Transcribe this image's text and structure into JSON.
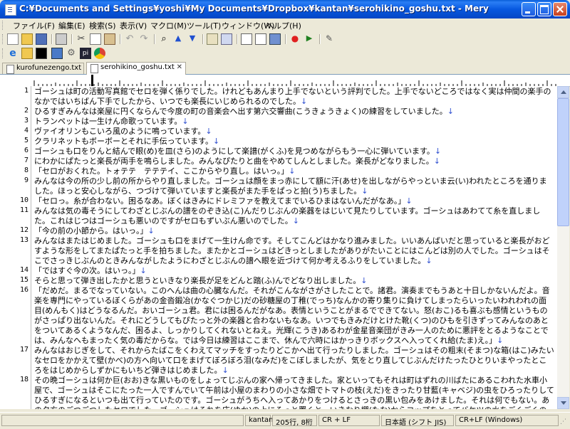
{
  "window": {
    "title": "C:¥Documents and Settings¥yoshi¥My Documents¥Dropbox¥kantan¥serohikino_goshu.txt - Mery"
  },
  "menu": [
    "ファイル(F)",
    "編集(E)",
    "検索(S)",
    "表示(V)",
    "マクロ(M)",
    "ツール(T)",
    "ウィンドウ(W)",
    "ヘルプ(H)"
  ],
  "toolbar": {
    "row1": [
      "new-file-icon",
      "open-file-icon",
      "save-icon",
      "print-icon",
      "cut-icon",
      "copy-icon",
      "paste-icon",
      "undo-icon",
      "redo-icon",
      "find-icon",
      "find-previous-icon",
      "find-next-icon",
      "replace-icon",
      "jump-icon",
      "word-wrap-icon",
      "window-icon",
      "split-icon",
      "record-macro-icon",
      "play-macro-icon",
      "tool-icon"
    ],
    "row2": [
      "ie-icon",
      "folder-icon",
      "command-prompt-icon",
      "notepad-icon",
      "settings-icon",
      "pdf-icon",
      "chrome-icon"
    ]
  },
  "tabs": [
    {
      "label": "kurofunezengo.txt",
      "active": false
    },
    {
      "label": "serohikino_goshu.txt",
      "active": true
    }
  ],
  "editor": {
    "lines": [
      {
        "num": "1",
        "text": "ゴーシュは町の活動写真館でセロを弾く係りでした。けれどもあんまり上手でないという評判でした。上手でないどころではなく実は仲間の楽手のなかではいちばん下手でしたから、いつでも楽長にいじめられるのでした。"
      },
      {
        "num": "2",
        "text": "ひるすぎみんなは楽屋に円くならんで今度の町の音楽会へ出す第六交響曲(こうきょうきょく)の練習をしていました。"
      },
      {
        "num": "3",
        "text": "トランペットは一生けん命歌っています。"
      },
      {
        "num": "4",
        "text": "ヴァイオリンもこいろ風のように鳴っています。"
      },
      {
        "num": "5",
        "text": "クラリネットもボーボーとそれに手伝っています。"
      },
      {
        "num": "6",
        "text": "ゴーシュも口をりんと結んで眼(め)を皿(さら)のようにして楽譜(がくふ)を見つめながらもう一心に弾いています。"
      },
      {
        "num": "7",
        "text": "にわかにぱたっと楽長が両手を鳴らしました。みんなぴたりと曲をやめてしんとしました。楽長がどなりました。"
      },
      {
        "num": "8",
        "text": "「セロがおくれた。トォテテ　テテテイ、ここからやり直し。はいっ。」"
      },
      {
        "num": "9",
        "text": "みんなは今の所の少し前の所からやり直しました。ゴーシュは顔をまっ赤にして額に汗(あせ)を出しながらやっといま云(い)われたところを通りました。ほっと安心しながら、つづけて弾いていますと楽長がまた手をぱっと拍(う)ちました。"
      },
      {
        "num": "10",
        "text": "「セロっ。糸が合わない。困るなあ。ぼくはきみにドレミファを教えてまでいるひまはないんだがなあ。」"
      },
      {
        "num": "11",
        "text": "みんなは気の毒そうにしてわざとじぶんの譜をのぞき込(こ)んだりじぶんの楽器をはじいて見たりしています。ゴーシュはあわてて糸を直しました。これはじつはゴーシュも悪いのですがセロもずいぶん悪いのでした。"
      },
      {
        "num": "12",
        "text": "「今の前の小節から。はいっ。」"
      },
      {
        "num": "13",
        "text": "みんなはまたはじめました。ゴーシュも口をまげて一生けん命です。そしてこんどはかなり進みました。いいあんばいだと思っていると楽長がおどすような形をしてまたぱたっと手を拍ちました。またかとゴーシュはどきっとしましたがありがたいことにはこんどは別の人でした。ゴーシュはそこでさっきじぶんのときみんながしたようにわざとじぶんの譜へ眼を近づけて何か考えるふりをしていました。"
      },
      {
        "num": "14",
        "text": "「ではすぐ今の次。はいっ。」"
      },
      {
        "num": "15",
        "text": "そらと思って弾き出したかと思うといきなり楽長が足をどんと踏(ふ)んでどなり出しました。"
      },
      {
        "num": "16",
        "text": "「だめだ。まるでなっていない。このへんは曲の心臓なんだ。それがこんながさがさしたことで。諸君。演奏までもうあと十日しかないんだよ。音楽を専門にやっているぼくらがあの金沓鍛冶(かなぐつかじ)だの砂糖屋の丁稚(でっち)なんかの寄り集りに負けてしまったらいったいわれわれの面目(めんもく)はどうなるんだ。おいゴーシュ君。君には困るんだがなあ。表情ということがまるでできてない。怒(おこ)るも喜ぶも感情というものがさっぱり出ないんだ。それにどうしてもぴたっと外の楽器と合わないもなあ。いつでもきみだけとけた靴(くつ)のひもを引きずってみんなのあとをついてあるくようなんだ、困るよ、しっかりしてくれないとねえ。光輝(こうき)あるわが金星音楽団がきみ一人のために悪評をとるようなことでは、みんなへもまったく気の毒だからな。では今日は練習はここまで、休んで六時にはかっきりボックスへ入ってくれ給(たま)え。」"
      },
      {
        "num": "17",
        "text": "みんなはおじぎをして、それからたばこをくわえてマッチをすったりどこかへ出て行ったりしました。ゴーシュはその粗末(そまつ)な箱(はこ)みたいなセロをかかえて壁(かべ)の方へ向いて口をまげてぼろぼろ泪(なみだ)をこぼしましたが、気をとり直してじぶんだけたったひとりいまやったところをはじめからしずかにもいちど弾きはじめました。"
      },
      {
        "num": "18",
        "text": "その晩ゴーシュは何か巨(おお)きな黒いものをしょってじぶんの家へ帰ってきました。家といってもそれは町はずれの川ばたにあるこわれた水車小屋で、ゴーシュはそこにたった一人ですんでいて午前は小屋のまわりの小さな畑でトマトの枝(えだ)をきったり甘藍(キャベジ)の虫をひろったりしてひるすぎになるといつも出て行っていたのです。ゴーシュがうちへ入ってあかりをつけるとさっきの黒い包みをあけました。それは何でもない。あの夕方のごつごつしたセロでした。ゴーシュはそれを床(ゆか)の上にそっと置くと、いきなり棚(たな)からコップをとってバケツの水をごくごくのみました。"
      }
    ],
    "newline_mark": "↓"
  },
  "status": {
    "empty": "",
    "mode": "kantan",
    "position": "205行, 8桁",
    "newline": "CR + LF",
    "encoding": "日本語 (シフト JIS)",
    "newline2": "CR+LF (Windows)"
  },
  "colors": {
    "titlebar": "#0a5fd8",
    "newline_mark": "#3050d0",
    "ruby": "#3050d0"
  }
}
